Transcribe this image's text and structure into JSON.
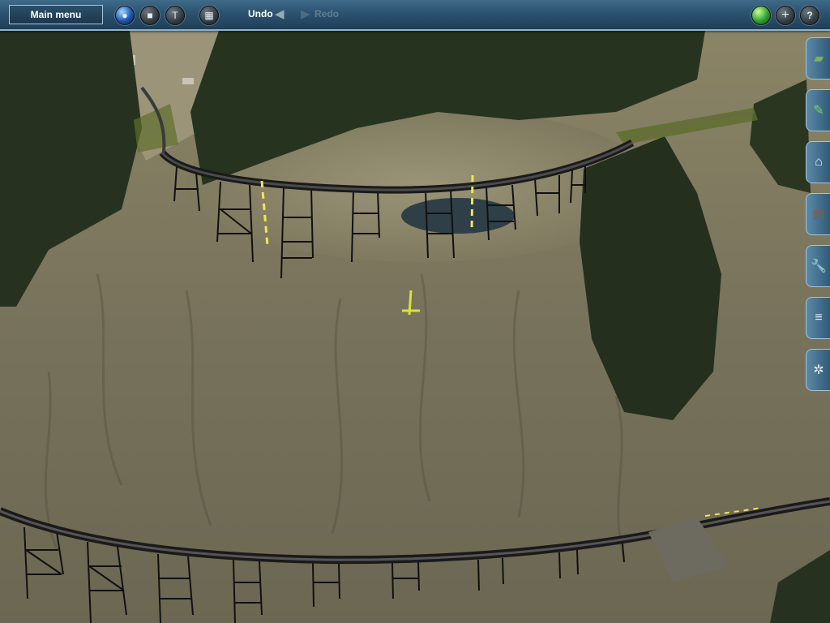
{
  "toolbar": {
    "main_menu_label": "Main menu",
    "undo_label": "Undo",
    "redo_label": "Redo",
    "left_tools": [
      {
        "name": "view-mode-icon",
        "glyph": "●",
        "color": "#2a62c4"
      },
      {
        "name": "stop-icon",
        "glyph": "■",
        "color": "#6b7780"
      },
      {
        "name": "track-tool-icon",
        "glyph": "T",
        "color": "#6b7780"
      },
      {
        "name": "grid-icon",
        "glyph": "▦",
        "color": "#6b7780"
      }
    ],
    "right_tools": [
      {
        "name": "status-light-icon",
        "glyph": "●",
        "color": "#2ca02c"
      },
      {
        "name": "add-icon",
        "glyph": "+",
        "color": "#6b7780"
      },
      {
        "name": "help-icon",
        "glyph": "?",
        "color": "#6b7780"
      }
    ]
  },
  "side_palette": [
    {
      "name": "terrain-tool-tab",
      "glyph": "▰"
    },
    {
      "name": "paint-tool-tab",
      "glyph": "✎"
    },
    {
      "name": "objects-tool-tab",
      "glyph": "⌂"
    },
    {
      "name": "track-tool-tab",
      "glyph": "▤"
    },
    {
      "name": "wrench-tool-tab",
      "glyph": "🔧"
    },
    {
      "name": "layers-tool-tab",
      "glyph": "≡"
    },
    {
      "name": "compass-tool-tab",
      "glyph": "✲"
    }
  ]
}
